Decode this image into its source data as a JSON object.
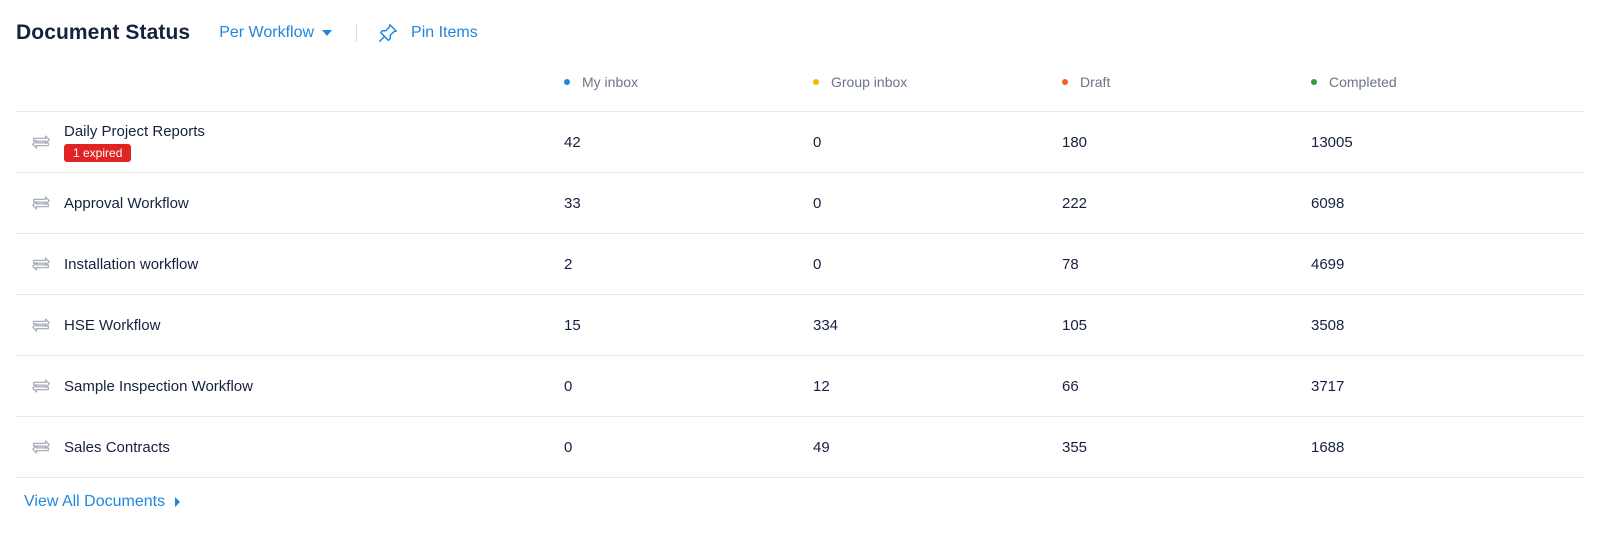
{
  "header": {
    "title": "Document Status",
    "dropdown_label": "Per Workflow",
    "pin_label": "Pin Items"
  },
  "columns": [
    {
      "label": "My inbox",
      "color": "#1f86e0"
    },
    {
      "label": "Group inbox",
      "color": "#f5b400"
    },
    {
      "label": "Draft",
      "color": "#f0621d"
    },
    {
      "label": "Completed",
      "color": "#22a33c"
    }
  ],
  "rows": [
    {
      "name": "Daily Project Reports",
      "badge": "1 expired",
      "my_inbox": "42",
      "group_inbox": "0",
      "draft": "180",
      "completed": "13005"
    },
    {
      "name": "Approval Workflow",
      "my_inbox": "33",
      "group_inbox": "0",
      "draft": "222",
      "completed": "6098"
    },
    {
      "name": "Installation workflow",
      "my_inbox": "2",
      "group_inbox": "0",
      "draft": "78",
      "completed": "4699"
    },
    {
      "name": "HSE Workflow",
      "my_inbox": "15",
      "group_inbox": "334",
      "draft": "105",
      "completed": "3508"
    },
    {
      "name": "Sample Inspection Workflow",
      "my_inbox": "0",
      "group_inbox": "12",
      "draft": "66",
      "completed": "3717"
    },
    {
      "name": "Sales Contracts",
      "my_inbox": "0",
      "group_inbox": "49",
      "draft": "355",
      "completed": "1688"
    }
  ],
  "footer": {
    "link_label": "View All Documents"
  }
}
